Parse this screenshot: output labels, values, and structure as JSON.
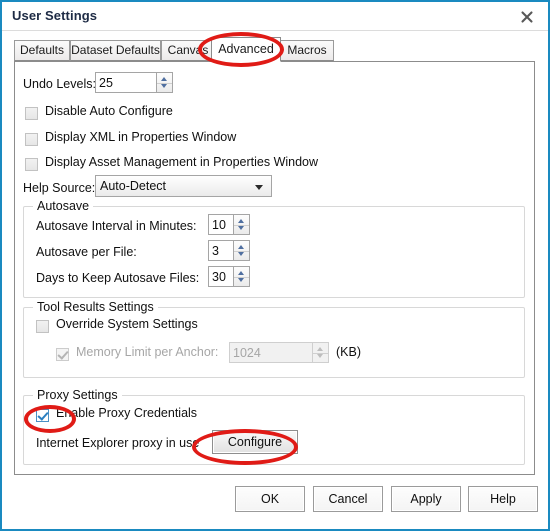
{
  "window": {
    "title": "User Settings",
    "close_icon": "close-icon",
    "border_color": "#1a8ac0"
  },
  "tabs": [
    {
      "label": "Defaults",
      "selected": false
    },
    {
      "label": "Dataset Defaults",
      "selected": false
    },
    {
      "label": "Canvas",
      "selected": false
    },
    {
      "label": "Advanced",
      "selected": true
    },
    {
      "label": "Macros",
      "selected": false
    }
  ],
  "advanced": {
    "undo": {
      "label": "Undo Levels:",
      "value": "25"
    },
    "checkboxes": [
      {
        "label": "Disable Auto Configure",
        "checked": false
      },
      {
        "label": "Display XML in Properties Window",
        "checked": false
      },
      {
        "label": "Display Asset Management in Properties Window",
        "checked": false
      }
    ],
    "help_source": {
      "label": "Help Source:",
      "value": "Auto-Detect",
      "options": [
        "Auto-Detect"
      ]
    },
    "autosave": {
      "title": "Autosave",
      "rows": [
        {
          "label": "Autosave Interval in Minutes:",
          "value": "10"
        },
        {
          "label": "Autosave per File:",
          "value": "3"
        },
        {
          "label": "Days to Keep Autosave Files:",
          "value": "30"
        }
      ]
    },
    "tool_results": {
      "title": "Tool Results Settings",
      "override": {
        "label": "Override System Settings",
        "checked": false
      },
      "memory_limit": {
        "label": "Memory Limit per Anchor:",
        "checked": true,
        "value": "1024",
        "units": "(KB)",
        "disabled": true
      }
    },
    "proxy": {
      "title": "Proxy Settings",
      "enable_credentials": {
        "label": "Enable Proxy Credentials",
        "checked": true
      },
      "status_text": "Internet Explorer proxy in use",
      "configure_label": "Configure"
    }
  },
  "dialog_buttons": [
    {
      "label": "OK"
    },
    {
      "label": "Cancel"
    },
    {
      "label": "Apply"
    },
    {
      "label": "Help"
    }
  ],
  "annotations": {
    "color": "#e01b16",
    "ellipses": [
      {
        "name": "advanced-tab-highlight"
      },
      {
        "name": "proxy-credentials-checkbox-highlight"
      },
      {
        "name": "configure-button-highlight"
      }
    ]
  }
}
